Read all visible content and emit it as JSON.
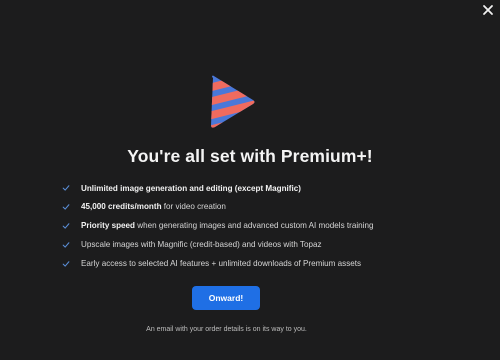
{
  "dialog": {
    "title": "You're all set with Premium+!",
    "features": [
      {
        "bold": "Unlimited image generation and editing (except Magnific)",
        "rest": ""
      },
      {
        "bold": "45,000 credits/month",
        "rest": " for video creation"
      },
      {
        "bold": "Priority speed",
        "rest": " when generating images and advanced custom AI models training"
      },
      {
        "bold": "",
        "rest": "Upscale images with Magnific (credit-based) and videos with Topaz"
      },
      {
        "bold": "",
        "rest": "Early access to selected AI features + unlimited downloads of Premium assets"
      }
    ],
    "cta_label": "Onward!",
    "footnote": "An email with your order details is on its way to you."
  },
  "icons": {
    "close": "close-icon",
    "check": "check-icon",
    "logo": "play-logo"
  },
  "colors": {
    "background": "#1c1c1d",
    "accent_blue": "#1f6fe5",
    "check_blue": "#5b8fd9",
    "logo_blue": "#4a78d9",
    "logo_coral": "#ef6b5f"
  }
}
